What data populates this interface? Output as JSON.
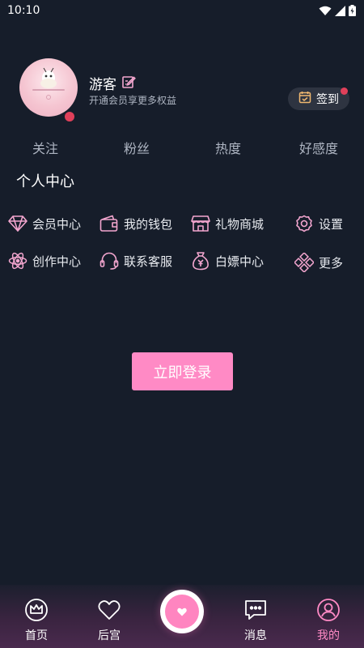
{
  "status_bar": {
    "time": "10:10"
  },
  "profile": {
    "username": "游客",
    "subtitle": "开通会员享更多权益",
    "checkin_label": "签到"
  },
  "stats": [
    "关注",
    "粉丝",
    "热度",
    "好感度"
  ],
  "section_title": "个人中心",
  "menu": {
    "member_center": "会员中心",
    "my_wallet": "我的钱包",
    "gift_mall": "礼物商城",
    "settings": "设置",
    "creator_center": "创作中心",
    "customer_service": "联系客服",
    "free_center": "白嫖中心",
    "more": "更多"
  },
  "login_button": "立即登录",
  "tabbar": {
    "home": "首页",
    "harem": "后宫",
    "messages": "消息",
    "mine": "我的",
    "active": "mine"
  },
  "colors": {
    "background": "#161d2a",
    "accent": "#ff8ac5",
    "icon_pink": "#f3a6cf",
    "badge_red": "#e0405a"
  }
}
